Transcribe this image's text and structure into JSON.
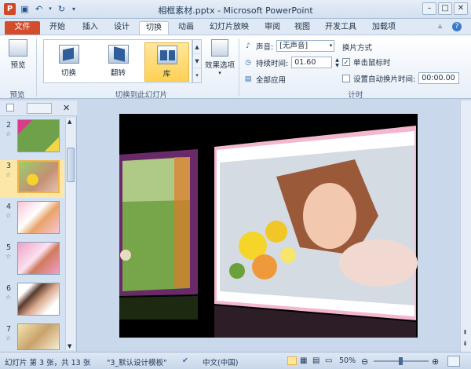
{
  "window": {
    "title": "相框素材.pptx - Microsoft PowerPoint"
  },
  "tabs": [
    "文件",
    "开始",
    "插入",
    "设计",
    "切换",
    "动画",
    "幻灯片放映",
    "审阅",
    "视图",
    "开发工具",
    "加载项"
  ],
  "active_tab": "切换",
  "ribbon": {
    "preview": {
      "label": "预览",
      "group": "预览"
    },
    "gallery": {
      "items": [
        "切换",
        "翻转",
        "库"
      ],
      "selected": "库",
      "group": "切换到此幻灯片"
    },
    "effect_options": {
      "label": "效果选项"
    },
    "timing": {
      "sound_label": "声音:",
      "sound_value": "[无声音]",
      "duration_label": "持续时间:",
      "duration_value": "01.60",
      "apply_all_label": "全部应用",
      "advance_heading": "换片方式",
      "on_click_label": "单击鼠标时",
      "on_click_checked": true,
      "after_label": "设置自动换片时间:",
      "after_value": "00:00.00",
      "after_checked": false,
      "group": "计时"
    }
  },
  "slides_pane": {
    "thumbnails": [
      {
        "num": "2",
        "star": "☆"
      },
      {
        "num": "3",
        "star": "☆"
      },
      {
        "num": "4",
        "star": "☆"
      },
      {
        "num": "5",
        "star": "☆"
      },
      {
        "num": "6",
        "star": "☆"
      },
      {
        "num": "7",
        "star": "☆"
      }
    ],
    "selected": "3"
  },
  "status": {
    "slide_info": "幻灯片 第 3 张，共 13 张",
    "theme": "\"3_默认设计模板\"",
    "language": "中文(中国)",
    "zoom": "50%"
  },
  "colors": {
    "accent": "#d34d2d",
    "selection": "#ffd155"
  }
}
